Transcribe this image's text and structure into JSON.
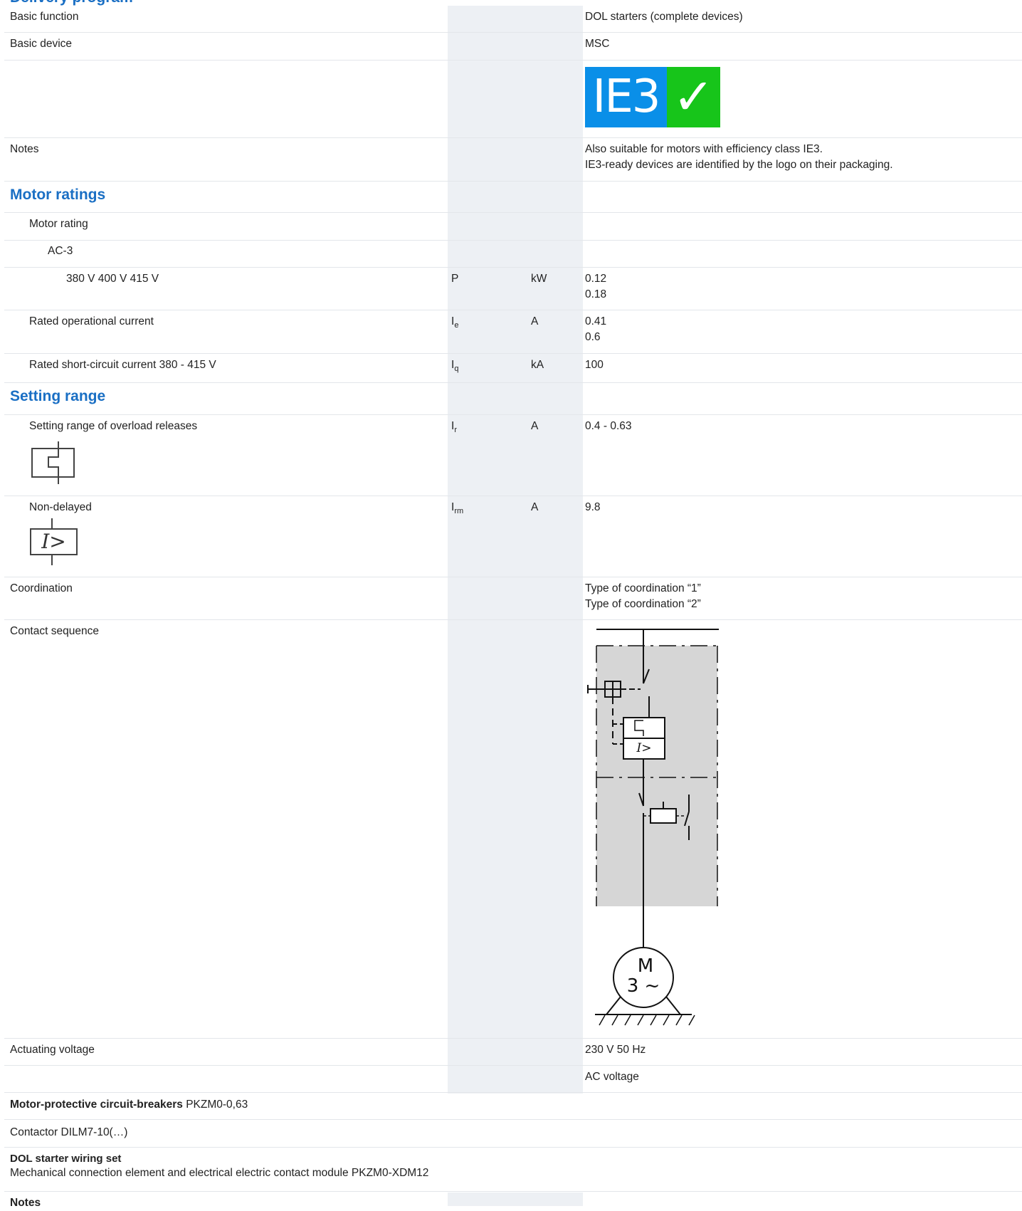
{
  "section_top": "Delivery program",
  "rows": {
    "basic_function": {
      "label": "Basic function",
      "value": "DOL starters (complete devices)"
    },
    "basic_device": {
      "label": "Basic device",
      "value": "MSC"
    },
    "ie3_logo": {
      "text": "IE3",
      "check": "✓",
      "color_blue": "#0a8fe8",
      "color_green": "#17c51a"
    },
    "notes": {
      "label": "Notes",
      "value_line1": "Also suitable for motors with efficiency class IE3.",
      "value_line2": "IE3-ready devices are identified by the logo on their packaging."
    }
  },
  "motor_ratings": {
    "heading": "Motor ratings",
    "motor_rating": "Motor rating",
    "ac3": "AC-3",
    "voltage": {
      "label": "380 V 400 V 415 V",
      "symbol": "P",
      "unit": "kW",
      "value1": "0.12",
      "value2": "0.18"
    },
    "current": {
      "label": "Rated operational current",
      "symbol": "I",
      "symbol_sub": "e",
      "unit": "A",
      "value1": "0.41",
      "value2": "0.6"
    },
    "short_circuit": {
      "label": "Rated short-circuit current 380 - 415 V",
      "symbol": "I",
      "symbol_sub": "q",
      "unit": "kA",
      "value": "100"
    }
  },
  "setting_range": {
    "heading": "Setting range",
    "overload": {
      "label": "Setting range of overload releases",
      "symbol": "I",
      "symbol_sub": "r",
      "unit": "A",
      "value": "0.4 - 0.63"
    },
    "non_delayed": {
      "label": "Non-delayed",
      "symbol": "I",
      "symbol_sub": "rm",
      "unit": "A",
      "value": "9.8",
      "icon_text": "I>"
    }
  },
  "coordination": {
    "label": "Coordination",
    "value_line1": "Type of coordination “1”",
    "value_line2": "Type of coordination “2”"
  },
  "contact_sequence": {
    "label": "Contact sequence",
    "diagram_i": "I>",
    "motor_m": "M",
    "motor_3": "3 ~"
  },
  "actuating_voltage": {
    "label": "Actuating voltage",
    "value": "230 V 50 Hz",
    "value2": "AC voltage"
  },
  "components": {
    "mpcb_bold": "Motor-protective circuit-breakers",
    "mpcb_rest": " PKZM0-0,63",
    "contactor": "Contactor DILM7-10(…)",
    "wiring_bold": "DOL starter wiring set",
    "wiring_rest": "Mechanical connection element and electrical electric contact module PKZM0-XDM12",
    "notes_bold": "Notes"
  }
}
